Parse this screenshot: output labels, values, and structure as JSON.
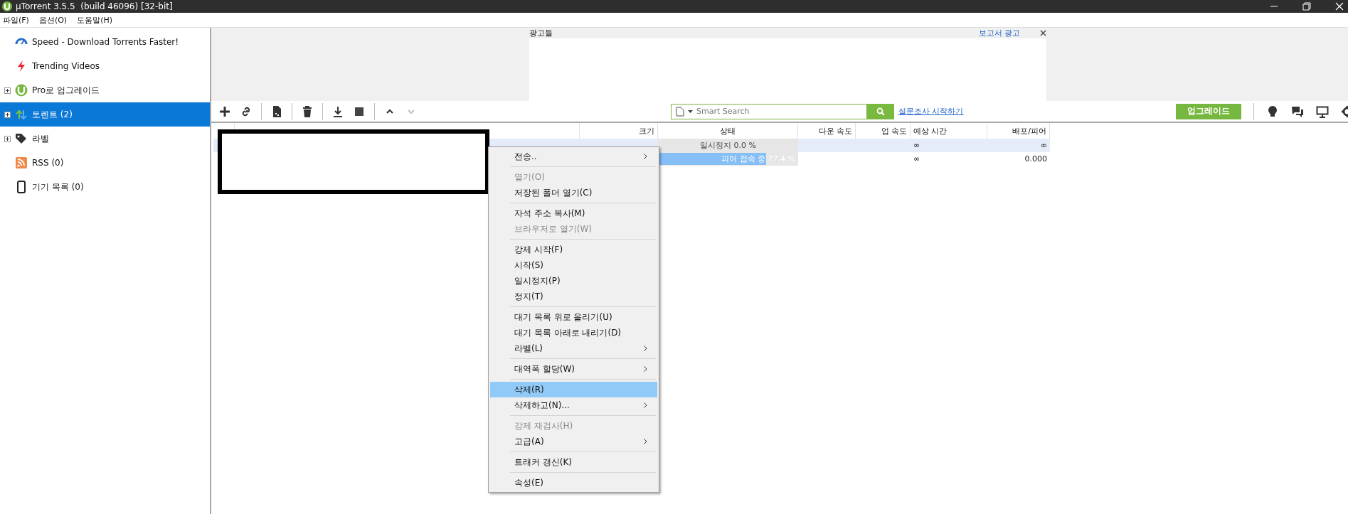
{
  "window": {
    "title": "µTorrent 3.5.5  (build 46096) [32-bit]"
  },
  "menu_bar": [
    "파일(F)",
    "옵션(O)",
    "도움말(H)"
  ],
  "sidebar": {
    "items": [
      {
        "kind": "speed",
        "label": "Speed - Download Torrents Faster!",
        "selected": false
      },
      {
        "kind": "trending",
        "label": "Trending Videos",
        "selected": false
      },
      {
        "kind": "pro",
        "label": "Pro로 업그레이드",
        "selected": false,
        "expanded": false
      },
      {
        "kind": "torrents",
        "label": "토렌트 (2)",
        "selected": true,
        "expanded": false
      },
      {
        "kind": "labels",
        "label": "라벨",
        "selected": false,
        "expanded": false
      },
      {
        "kind": "rss",
        "label": "RSS (0)",
        "selected": false
      },
      {
        "kind": "devices",
        "label": "기기 목록 (0)",
        "selected": false
      }
    ]
  },
  "ad": {
    "label": "광고들",
    "report_link": "보고서 광고"
  },
  "toolbar": {
    "buttons": [
      {
        "kind": "add",
        "disabled": false
      },
      {
        "kind": "link",
        "disabled": false
      },
      {
        "kind": "create",
        "disabled": false
      },
      {
        "kind": "delete",
        "disabled": false
      },
      {
        "kind": "download",
        "disabled": false
      },
      {
        "kind": "stop",
        "disabled": false
      },
      {
        "kind": "up",
        "disabled": false
      },
      {
        "kind": "down",
        "disabled": true
      }
    ],
    "search": {
      "placeholder": "Smart Search"
    },
    "survey_link": "설문조사 시작하기",
    "upgrade_button": "업그레이드",
    "right_buttons": [
      {
        "kind": "bulb"
      },
      {
        "kind": "chat"
      },
      {
        "kind": "monitor"
      },
      {
        "kind": "gear"
      }
    ]
  },
  "table": {
    "columns": [
      "크기",
      "상태",
      "다운 속도",
      "업 속도",
      "예상 시간",
      "배포/피어"
    ],
    "rows": [
      {
        "selected": true,
        "status": "일시정지 0.0 %",
        "level": 0,
        "eta": "∞",
        "ratio": "∞"
      },
      {
        "selected": false,
        "status": "피어 접속 중 77.4 %",
        "level": 0.774,
        "eta": "∞",
        "ratio": "0.000"
      }
    ]
  },
  "context_menu": {
    "items": [
      {
        "kind": "item",
        "label": "전송..",
        "disabled": false,
        "submenu": true,
        "selected": false
      },
      {
        "kind": "separator"
      },
      {
        "kind": "item",
        "label": "열기(O)",
        "disabled": true,
        "submenu": false,
        "selected": false
      },
      {
        "kind": "item",
        "label": "저장된 폴더 열기(C)",
        "disabled": false,
        "submenu": false,
        "selected": false
      },
      {
        "kind": "separator"
      },
      {
        "kind": "item",
        "label": "자석 주소 복사(M)",
        "disabled": false,
        "submenu": false,
        "selected": false
      },
      {
        "kind": "item",
        "label": "브라우저로 열기(W)",
        "disabled": true,
        "submenu": false,
        "selected": false
      },
      {
        "kind": "separator"
      },
      {
        "kind": "item",
        "label": "강제 시작(F)",
        "disabled": false,
        "submenu": false,
        "selected": false
      },
      {
        "kind": "item",
        "label": "시작(S)",
        "disabled": false,
        "submenu": false,
        "selected": false
      },
      {
        "kind": "item",
        "label": "일시정지(P)",
        "disabled": false,
        "submenu": false,
        "selected": false
      },
      {
        "kind": "item",
        "label": "정지(T)",
        "disabled": false,
        "submenu": false,
        "selected": false
      },
      {
        "kind": "separator"
      },
      {
        "kind": "item",
        "label": "대기 목록 위로 올리기(U)",
        "disabled": false,
        "submenu": false,
        "selected": false
      },
      {
        "kind": "item",
        "label": "대기 목록 아래로 내리기(D)",
        "disabled": false,
        "submenu": false,
        "selected": false
      },
      {
        "kind": "item",
        "label": "라벨(L)",
        "disabled": false,
        "submenu": true,
        "selected": false
      },
      {
        "kind": "separator"
      },
      {
        "kind": "item",
        "label": "대역폭 할당(W)",
        "disabled": false,
        "submenu": true,
        "selected": false
      },
      {
        "kind": "separator"
      },
      {
        "kind": "item",
        "label": "삭제(R)",
        "disabled": false,
        "submenu": false,
        "selected": true
      },
      {
        "kind": "item",
        "label": "삭제하고(N)...",
        "disabled": false,
        "submenu": true,
        "selected": false
      },
      {
        "kind": "separator"
      },
      {
        "kind": "item",
        "label": "강제 재검사(H)",
        "disabled": true,
        "submenu": false,
        "selected": false
      },
      {
        "kind": "item",
        "label": "고급(A)",
        "disabled": false,
        "submenu": true,
        "selected": false
      },
      {
        "kind": "separator"
      },
      {
        "kind": "item",
        "label": "트래커 갱신(K)",
        "disabled": false,
        "submenu": false,
        "selected": false
      },
      {
        "kind": "separator"
      },
      {
        "kind": "item",
        "label": "속성(E)",
        "disabled": false,
        "submenu": false,
        "selected": false
      }
    ]
  }
}
